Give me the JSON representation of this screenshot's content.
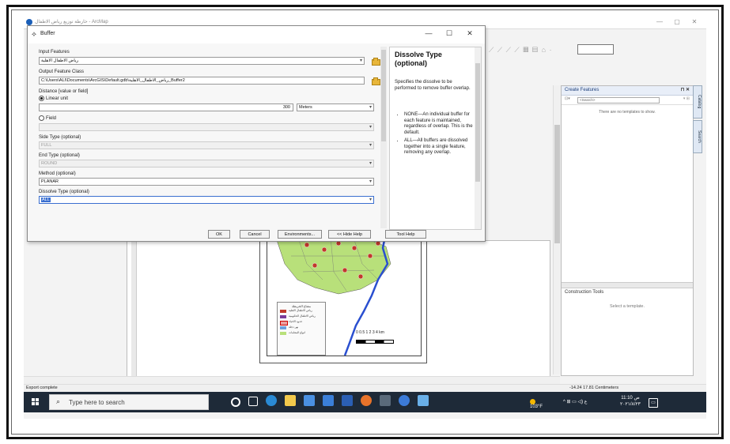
{
  "app": {
    "title": "خارطة توزيع رياض الاطفال - ArcMap",
    "win_minimize": "—",
    "win_maximize": "▢",
    "win_close": "✕"
  },
  "dialog": {
    "title": "Buffer",
    "minimize": "—",
    "maximize": "☐",
    "close": "✕",
    "input_features_label": "Input Features",
    "input_features_value": "رياض الاطفال الاهلية",
    "output_fc_label": "Output Feature Class",
    "output_fc_value": "C:\\Users\\ALI\\Documents\\ArcGIS\\Default.gdb\\رياض_الاطفال_الاهلية_Buffer2",
    "distance_label": "Distance [value or field]",
    "linear_unit_label": "Linear unit",
    "distance_value": "300",
    "distance_unit": "Meters",
    "field_label": "Field",
    "side_type_label": "Side Type (optional)",
    "side_type_value": "FULL",
    "end_type_label": "End Type (optional)",
    "end_type_value": "ROUND",
    "method_label": "Method (optional)",
    "method_value": "PLANAR",
    "dissolve_label": "Dissolve Type (optional)",
    "dissolve_value": "ALL",
    "buttons": {
      "ok": "OK",
      "cancel": "Cancel",
      "environments": "Environments...",
      "hide_help": "<< Hide Help",
      "tool_help": "Tool Help"
    }
  },
  "help": {
    "title": "Dissolve Type (optional)",
    "description": "Specifies the dissolve to be performed to remove buffer overlap.",
    "items": [
      "NONE—An individual buffer for each feature is maintained, regardless of overlap. This is the default.",
      "ALL—All buffers are dissolved together into a single feature, removing any overlap."
    ]
  },
  "create_features": {
    "title": "Create Features",
    "search_placeholder": "<Search>",
    "empty_text": "There are no templates to show.",
    "construction_tools": "Construction Tools",
    "select_template": "Select a template."
  },
  "side_tabs": [
    "Catalog",
    "Search"
  ],
  "legend": {
    "title": "مفتاح الخريطة",
    "rows": [
      {
        "label": "رياض الاطفال الاهلية",
        "color": "#c0392b"
      },
      {
        "label": "رياض الاطفال الحكومية",
        "color": "#7a3b9a"
      },
      {
        "label": "حدود الاحياء",
        "color": "#e9a0a0"
      },
      {
        "label": "نهر دجلة",
        "color": "#6aa0e0"
      },
      {
        "label": "انواع المقامات",
        "color": "#b8e07a"
      }
    ]
  },
  "scalebar": {
    "labels": "0 0.5 1     2     3     4",
    "unit": "km"
  },
  "status": {
    "left": "Export complete",
    "right": "-14.24  17.81 Centimeters"
  },
  "taskbar": {
    "search_placeholder": "Type here to search",
    "weather": "103°F",
    "tray_glyphs": "^ ⊞ ▭ ◁) ع",
    "time": "11:10 ص",
    "date": "٢٠٢١/٨/٢٣",
    "notify": "▭"
  },
  "colors": {
    "taskbar_bg": "#1e2a38",
    "folder": "#e8b63a",
    "map_fill": "#b8e07a",
    "river": "#2a4fd0"
  }
}
